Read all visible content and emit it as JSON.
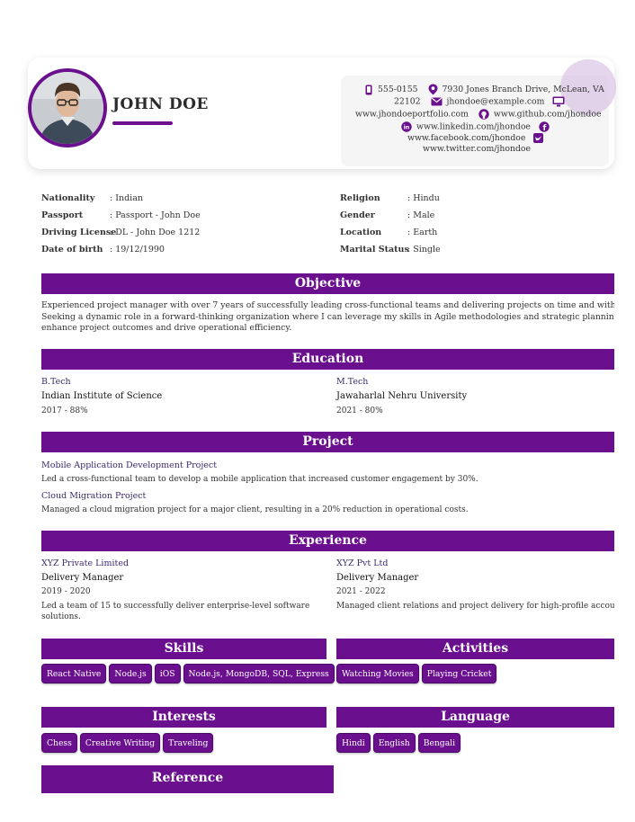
{
  "header": {
    "name": "JOHN DOE"
  },
  "contact": {
    "phone": "555-0155",
    "address_line1": "7930 Jones Branch Drive, McLean, VA",
    "address_line2": "22102",
    "email": "jhondoe@example.com",
    "portfolio": "www.jhondoeportfolio.com",
    "github": "www.github.com/jhondoe",
    "linkedin": "www.linkedin.com/jhondoe",
    "facebook": "www.facebook.com/jhondoe",
    "twitter": "www.twitter.com/jhondoe"
  },
  "personal": {
    "left": [
      {
        "label": "Nationality",
        "value": ": Indian"
      },
      {
        "label": "Passport",
        "value": ": Passport - John Doe"
      },
      {
        "label": "Driving License",
        "value": ": DL - John Doe 1212"
      },
      {
        "label": "Date of birth",
        "value": ": 19/12/1990"
      }
    ],
    "right": [
      {
        "label": "Religion",
        "value": ": Hindu"
      },
      {
        "label": "Gender",
        "value": ": Male"
      },
      {
        "label": "Location",
        "value": ": Earth"
      },
      {
        "label": "Marital Status",
        "value": ": Single"
      }
    ]
  },
  "objective": {
    "title": "Objective",
    "lines": [
      "Experienced project manager with over 7 years of successfully leading cross-functional teams and delivering projects on time and within budget.",
      "Seeking a dynamic role in a forward-thinking organization where I can leverage my skills in Agile methodologies and strategic planning to",
      "enhance project outcomes and drive operational efficiency."
    ]
  },
  "education": {
    "title": "Education",
    "items": [
      {
        "degree": "B.Tech",
        "institute": "Indian Institute of Science",
        "year": "2017 - 88%"
      },
      {
        "degree": "M.Tech",
        "institute": "Jawaharlal Nehru University",
        "year": "2021 - 80%"
      }
    ]
  },
  "project": {
    "title": "Project",
    "items": [
      {
        "name": "Mobile Application Development Project",
        "desc": "Led a cross-functional team to develop a mobile application that increased customer engagement by 30%."
      },
      {
        "name": "Cloud Migration Project",
        "desc": "Managed a cloud migration project for a major client, resulting in a 20% reduction in operational costs."
      }
    ]
  },
  "experience": {
    "title": "Experience",
    "items": [
      {
        "company": "XYZ Private Limited",
        "role": "Delivery Manager",
        "years": "2019 - 2020",
        "desc1": "Led a team of 15 to successfully deliver enterprise-level software",
        "desc2": "solutions."
      },
      {
        "company": "XYZ Pvt Ltd",
        "role": "Delivery Manager",
        "years": "2021 - 2022",
        "desc1": "Managed client relations and project delivery for high-profile accounts.",
        "desc2": ""
      }
    ]
  },
  "skills": {
    "title": "Skills",
    "items": [
      "React Native",
      "Node.js",
      "iOS",
      "Node.js, MongoDB, SQL, Express"
    ]
  },
  "activities": {
    "title": "Activities",
    "items": [
      "Watching Movies",
      "Playing Cricket"
    ]
  },
  "interests": {
    "title": "Interests",
    "items": [
      "Chess",
      "Creative Writing",
      "Traveling"
    ]
  },
  "language": {
    "title": "Language",
    "items": [
      "Hindi",
      "English",
      "Bengali"
    ]
  },
  "reference": {
    "title": "Reference"
  },
  "colors": {
    "accent": "#6a0f8e",
    "light_accent": "#d1b4de"
  }
}
